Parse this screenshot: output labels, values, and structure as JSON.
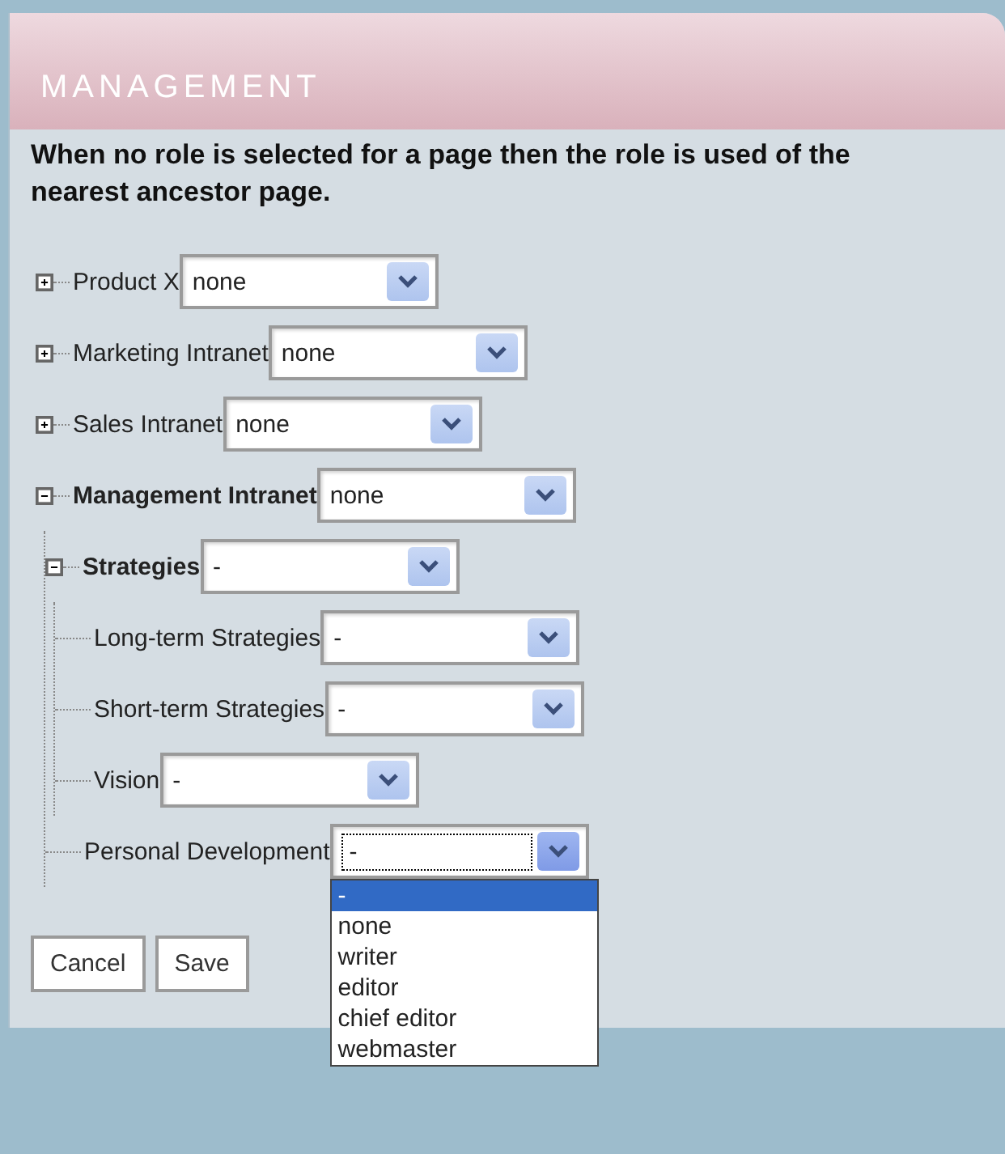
{
  "panel": {
    "title": "MANAGEMENT",
    "intro": "When no role is selected for a page then the role is used of the nearest ancestor page."
  },
  "tree": [
    {
      "label": "Product X",
      "kind": "folder",
      "expanded": false,
      "role": "none",
      "focused": false
    },
    {
      "label": "Marketing Intranet",
      "kind": "folder",
      "expanded": false,
      "role": "none",
      "focused": false
    },
    {
      "label": "Sales Intranet",
      "kind": "folder",
      "expanded": false,
      "role": "none",
      "focused": false
    },
    {
      "label": "Management Intranet",
      "kind": "folder",
      "expanded": true,
      "role": "none",
      "focused": false,
      "children": [
        {
          "label": "Strategies",
          "kind": "folder",
          "expanded": true,
          "role": "-",
          "focused": false,
          "children": [
            {
              "label": "Long-term Strategies",
              "kind": "page",
              "role": "-",
              "focused": false
            },
            {
              "label": "Short-term Strategies",
              "kind": "page",
              "role": "-",
              "focused": false
            },
            {
              "label": "Vision",
              "kind": "page",
              "role": "-",
              "focused": false
            }
          ]
        },
        {
          "label": "Personal Development",
          "kind": "page",
          "role": "-",
          "focused": true,
          "options": [
            {
              "label": "-",
              "selected": true
            },
            {
              "label": "none",
              "selected": false
            },
            {
              "label": "writer",
              "selected": false
            },
            {
              "label": "editor",
              "selected": false
            },
            {
              "label": "chief editor",
              "selected": false
            },
            {
              "label": "webmaster",
              "selected": false
            }
          ]
        }
      ]
    }
  ],
  "buttons": [
    "Cancel",
    "Save"
  ]
}
